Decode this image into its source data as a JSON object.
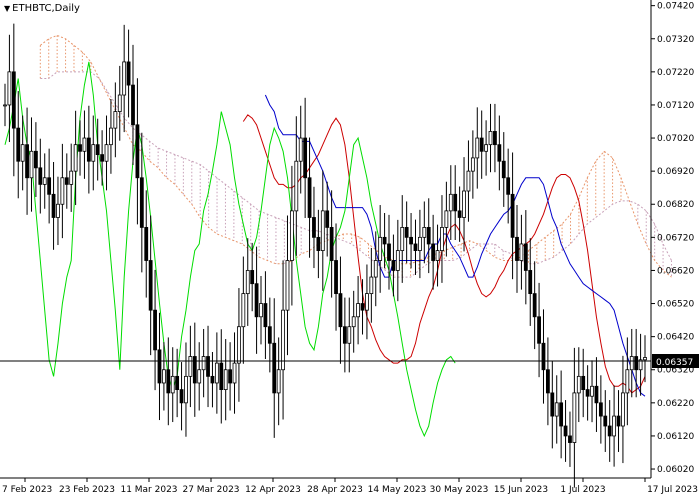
{
  "window": {
    "title": "ETHBTC,Daily",
    "dropdown_icon": "triangle-down-icon"
  },
  "colors": {
    "background": "#ffffff",
    "candles": "#000000",
    "tenkan": "#cc0000",
    "kijun": "#0000cc",
    "chikou": "#00dd00",
    "senkou_a": "#e8956a",
    "senkou_b": "#c8a0b8",
    "price_label_bg": "#000000",
    "price_label_text": "#ffffff"
  },
  "chart_data": {
    "type": "candlestick",
    "symbol": "ETHBTC",
    "timeframe": "Daily",
    "indicator": "Ichimoku Kinko Hyo",
    "current_price": "0.06357",
    "ylim": [
      0.06005,
      0.07425
    ],
    "y_ticks": [
      "0.07420",
      "0.07320",
      "0.07220",
      "0.07120",
      "0.07020",
      "0.06920",
      "0.06820",
      "0.06720",
      "0.06620",
      "0.06520",
      "0.06420",
      "0.06320",
      "0.06220",
      "0.06120",
      "0.06020"
    ],
    "x_ticks": [
      "7 Feb 2023",
      "23 Feb 2023",
      "11 Mar 2023",
      "27 Mar 2023",
      "12 Apr 2023",
      "28 Apr 2023",
      "14 May 2023",
      "30 May 2023",
      "15 Jun 2023",
      "1 Jul 2023",
      "17 Jul 2023"
    ],
    "close": [
      0.0712,
      0.0722,
      0.0705,
      0.0695,
      0.07,
      0.069,
      0.0698,
      0.0693,
      0.0688,
      0.069,
      0.0685,
      0.0678,
      0.0682,
      0.069,
      0.0688,
      0.0692,
      0.07,
      0.0698,
      0.0702,
      0.0695,
      0.07,
      0.0697,
      0.0695,
      0.07,
      0.0705,
      0.071,
      0.0715,
      0.0725,
      0.0718,
      0.0706,
      0.069,
      0.0675,
      0.0665,
      0.065,
      0.0638,
      0.0628,
      0.0632,
      0.0625,
      0.063,
      0.0626,
      0.0622,
      0.063,
      0.0636,
      0.0628,
      0.0632,
      0.0636,
      0.063,
      0.0628,
      0.0634,
      0.0626,
      0.0632,
      0.0628,
      0.0634,
      0.0645,
      0.0655,
      0.0662,
      0.0658,
      0.0648,
      0.0652,
      0.0645,
      0.064,
      0.0625,
      0.0632,
      0.065,
      0.0665,
      0.068,
      0.0695,
      0.0702,
      0.069,
      0.0678,
      0.0672,
      0.0668,
      0.068,
      0.0675,
      0.0665,
      0.0655,
      0.0645,
      0.064,
      0.0645,
      0.0648,
      0.0652,
      0.065,
      0.0655,
      0.066,
      0.0665,
      0.0672,
      0.067,
      0.0665,
      0.0662,
      0.0668,
      0.0675,
      0.0672,
      0.067,
      0.0668,
      0.0672,
      0.0675,
      0.067,
      0.0665,
      0.0668,
      0.0675,
      0.068,
      0.0685,
      0.068,
      0.0678,
      0.0686,
      0.0692,
      0.0696,
      0.0702,
      0.0698,
      0.07,
      0.0704,
      0.07,
      0.0695,
      0.069,
      0.0685,
      0.0672,
      0.0665,
      0.067,
      0.0662,
      0.0655,
      0.0648,
      0.064,
      0.0632,
      0.0625,
      0.0618,
      0.0622,
      0.0615,
      0.0612,
      0.061,
      0.0625,
      0.063,
      0.0626,
      0.0624,
      0.0627,
      0.0622,
      0.0618,
      0.0615,
      0.0612,
      0.0618,
      0.0615,
      0.0625,
      0.0632,
      0.0636,
      0.0632,
      0.0635,
      0.06357
    ],
    "tenkan": [
      0.0707,
      0.0709,
      0.0708,
      0.0706,
      0.0702,
      0.0698,
      0.0694,
      0.069,
      0.0688,
      0.0688,
      0.0687,
      0.0687,
      0.0688,
      0.069,
      0.0691,
      0.0693,
      0.0695,
      0.0697,
      0.07,
      0.0703,
      0.0706,
      0.0708,
      0.0706,
      0.07,
      0.069,
      0.0678,
      0.0666,
      0.0655,
      0.0648,
      0.0645,
      0.0641,
      0.0638,
      0.0636,
      0.0635,
      0.0634,
      0.0634,
      0.0635,
      0.0635,
      0.0636,
      0.064,
      0.0646,
      0.065,
      0.0654,
      0.0657,
      0.0662,
      0.0668,
      0.0672,
      0.0675,
      0.0676,
      0.0674,
      0.0671,
      0.0667,
      0.0662,
      0.0658,
      0.0655,
      0.0654,
      0.0655,
      0.0657,
      0.066,
      0.0662,
      0.0665,
      0.0667,
      0.0668,
      0.0669,
      0.067,
      0.0671,
      0.0673,
      0.0676,
      0.0679,
      0.0683,
      0.0687,
      0.069,
      0.0691,
      0.0691,
      0.069,
      0.0687,
      0.0683,
      0.0676,
      0.0668,
      0.0658,
      0.0648,
      0.064,
      0.0633,
      0.0629,
      0.0627,
      0.0627,
      0.0628,
      0.0627,
      0.0625,
      0.0626,
      0.0627,
      0.063
    ],
    "kijun": [
      0.0715,
      0.0712,
      0.071,
      0.0705,
      0.0703,
      0.0703,
      0.0703,
      0.0703,
      0.0701,
      0.0701,
      0.0701,
      0.0698,
      0.0695,
      0.0692,
      0.0688,
      0.0684,
      0.0681,
      0.0681,
      0.0681,
      0.0681,
      0.0681,
      0.0681,
      0.0681,
      0.0679,
      0.0675,
      0.0668,
      0.0663,
      0.066,
      0.066,
      0.0665,
      0.0665,
      0.0665,
      0.0665,
      0.0665,
      0.0665,
      0.0665,
      0.0665,
      0.0668,
      0.067,
      0.067,
      0.0673,
      0.0673,
      0.067,
      0.0668,
      0.0666,
      0.0663,
      0.066,
      0.066,
      0.0663,
      0.0667,
      0.067,
      0.0673,
      0.0675,
      0.0677,
      0.0679,
      0.068,
      0.0682,
      0.0685,
      0.0688,
      0.069,
      0.069,
      0.069,
      0.069,
      0.0688,
      0.0683,
      0.0678,
      0.0675,
      0.067,
      0.0667,
      0.0664,
      0.0662,
      0.066,
      0.0658,
      0.0657,
      0.0656,
      0.0655,
      0.0654,
      0.0653,
      0.0652,
      0.065,
      0.0645,
      0.064,
      0.0636,
      0.0632,
      0.0628,
      0.0625,
      0.0624
    ],
    "chikou": [
      0.07,
      0.0705,
      0.0712,
      0.072,
      0.0708,
      0.07,
      0.0695,
      0.068,
      0.0665,
      0.065,
      0.0635,
      0.063,
      0.064,
      0.0652,
      0.066,
      0.0665,
      0.069,
      0.0708,
      0.0718,
      0.0725,
      0.0715,
      0.07,
      0.069,
      0.068,
      0.0665,
      0.065,
      0.0632,
      0.066,
      0.068,
      0.0695,
      0.0705,
      0.07,
      0.069,
      0.0678,
      0.0665,
      0.0652,
      0.064,
      0.063,
      0.0626,
      0.063,
      0.0642,
      0.065,
      0.066,
      0.0668,
      0.067,
      0.068,
      0.0685,
      0.0692,
      0.07,
      0.071,
      0.0705,
      0.07,
      0.069,
      0.0682,
      0.0676,
      0.067,
      0.0668,
      0.0672,
      0.068,
      0.069,
      0.07,
      0.0705,
      0.0702,
      0.0698,
      0.069,
      0.0678,
      0.0665,
      0.0655,
      0.0645,
      0.064,
      0.0638,
      0.0645,
      0.0655,
      0.066,
      0.0668,
      0.0672,
      0.0675,
      0.068,
      0.069,
      0.07,
      0.0702,
      0.0696,
      0.069,
      0.0682,
      0.0676,
      0.067,
      0.0666,
      0.0662,
      0.0655,
      0.0648,
      0.064,
      0.0632,
      0.0626,
      0.062,
      0.0615,
      0.0612,
      0.0615,
      0.0622,
      0.0628,
      0.0632,
      0.0635,
      0.0636,
      0.0634
    ],
    "senkou_a": [
      0.073,
      0.0732,
      0.0733,
      0.0732,
      0.073,
      0.0728,
      0.0725,
      0.072,
      0.0715,
      0.071,
      0.0705,
      0.07,
      0.0698,
      0.0695,
      0.0693,
      0.069,
      0.0688,
      0.0685,
      0.0682,
      0.0678,
      0.0675,
      0.0673,
      0.0672,
      0.0671,
      0.067,
      0.0668,
      0.0666,
      0.0665,
      0.0664,
      0.0664,
      0.0665,
      0.0667,
      0.0668,
      0.067,
      0.0671,
      0.0672,
      0.0673,
      0.0673,
      0.0672,
      0.067,
      0.0668,
      0.0666,
      0.0665,
      0.0664,
      0.0664,
      0.0665,
      0.0666,
      0.0667,
      0.0668,
      0.0669,
      0.067,
      0.0671,
      0.067,
      0.0668,
      0.0666,
      0.0665,
      0.0665,
      0.0666,
      0.0668,
      0.067,
      0.0672,
      0.0674,
      0.0676,
      0.0679,
      0.0684,
      0.069,
      0.0695,
      0.0698,
      0.0696,
      0.069,
      0.0683,
      0.0676,
      0.067,
      0.0665,
      0.0662,
      0.066
    ],
    "senkou_b": [
      0.072,
      0.072,
      0.0722,
      0.0722,
      0.0722,
      0.0722,
      0.0722,
      0.072,
      0.0716,
      0.0712,
      0.0708,
      0.0705,
      0.0703,
      0.0701,
      0.0699,
      0.0698,
      0.0697,
      0.0696,
      0.0695,
      0.0694,
      0.0692,
      0.069,
      0.0688,
      0.0686,
      0.0684,
      0.0682,
      0.068,
      0.0679,
      0.0678,
      0.0677,
      0.0676,
      0.0675,
      0.0674,
      0.0674,
      0.0673,
      0.0672,
      0.0671,
      0.067,
      0.0668,
      0.0666,
      0.0664,
      0.0662,
      0.066,
      0.066,
      0.066,
      0.0662,
      0.0664,
      0.0665,
      0.0665,
      0.0665,
      0.0666,
      0.0668,
      0.067,
      0.067,
      0.067,
      0.0668,
      0.0667,
      0.0665,
      0.0664,
      0.0664,
      0.0665,
      0.0666,
      0.0668,
      0.067,
      0.0673,
      0.0676,
      0.0678,
      0.068,
      0.0682,
      0.0683,
      0.0683,
      0.0682,
      0.068,
      0.0676,
      0.067,
      0.0665
    ]
  }
}
